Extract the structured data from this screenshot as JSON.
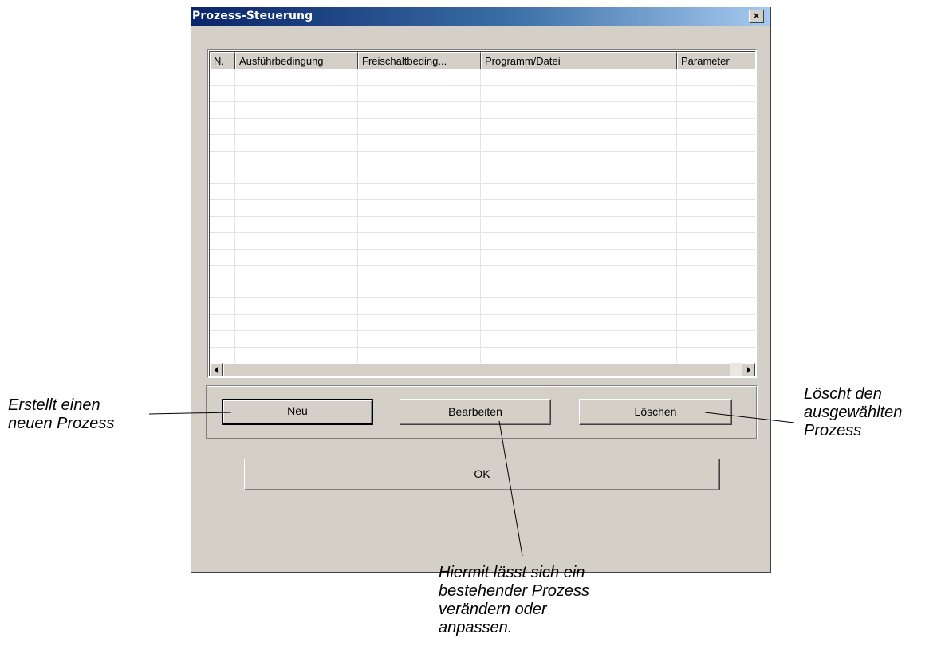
{
  "dialog": {
    "title": "Prozess-Steuerung",
    "close_label": "×"
  },
  "table": {
    "columns": [
      "N.",
      "Ausführbedingung",
      "Freischaltbeding...",
      "Programm/Datei",
      "Parameter"
    ],
    "rows": []
  },
  "buttons": {
    "new_label": "Neu",
    "edit_label": "Bearbeiten",
    "delete_label": "Löschen",
    "ok_label": "OK"
  },
  "annotations": {
    "new": [
      "Erstellt einen",
      "neuen Prozess"
    ],
    "delete": [
      "Löscht den",
      "ausgewählten",
      "Prozess"
    ],
    "edit": [
      "Hiermit lässt sich ein",
      "bestehender Prozess",
      "verändern oder",
      "anpassen."
    ]
  }
}
